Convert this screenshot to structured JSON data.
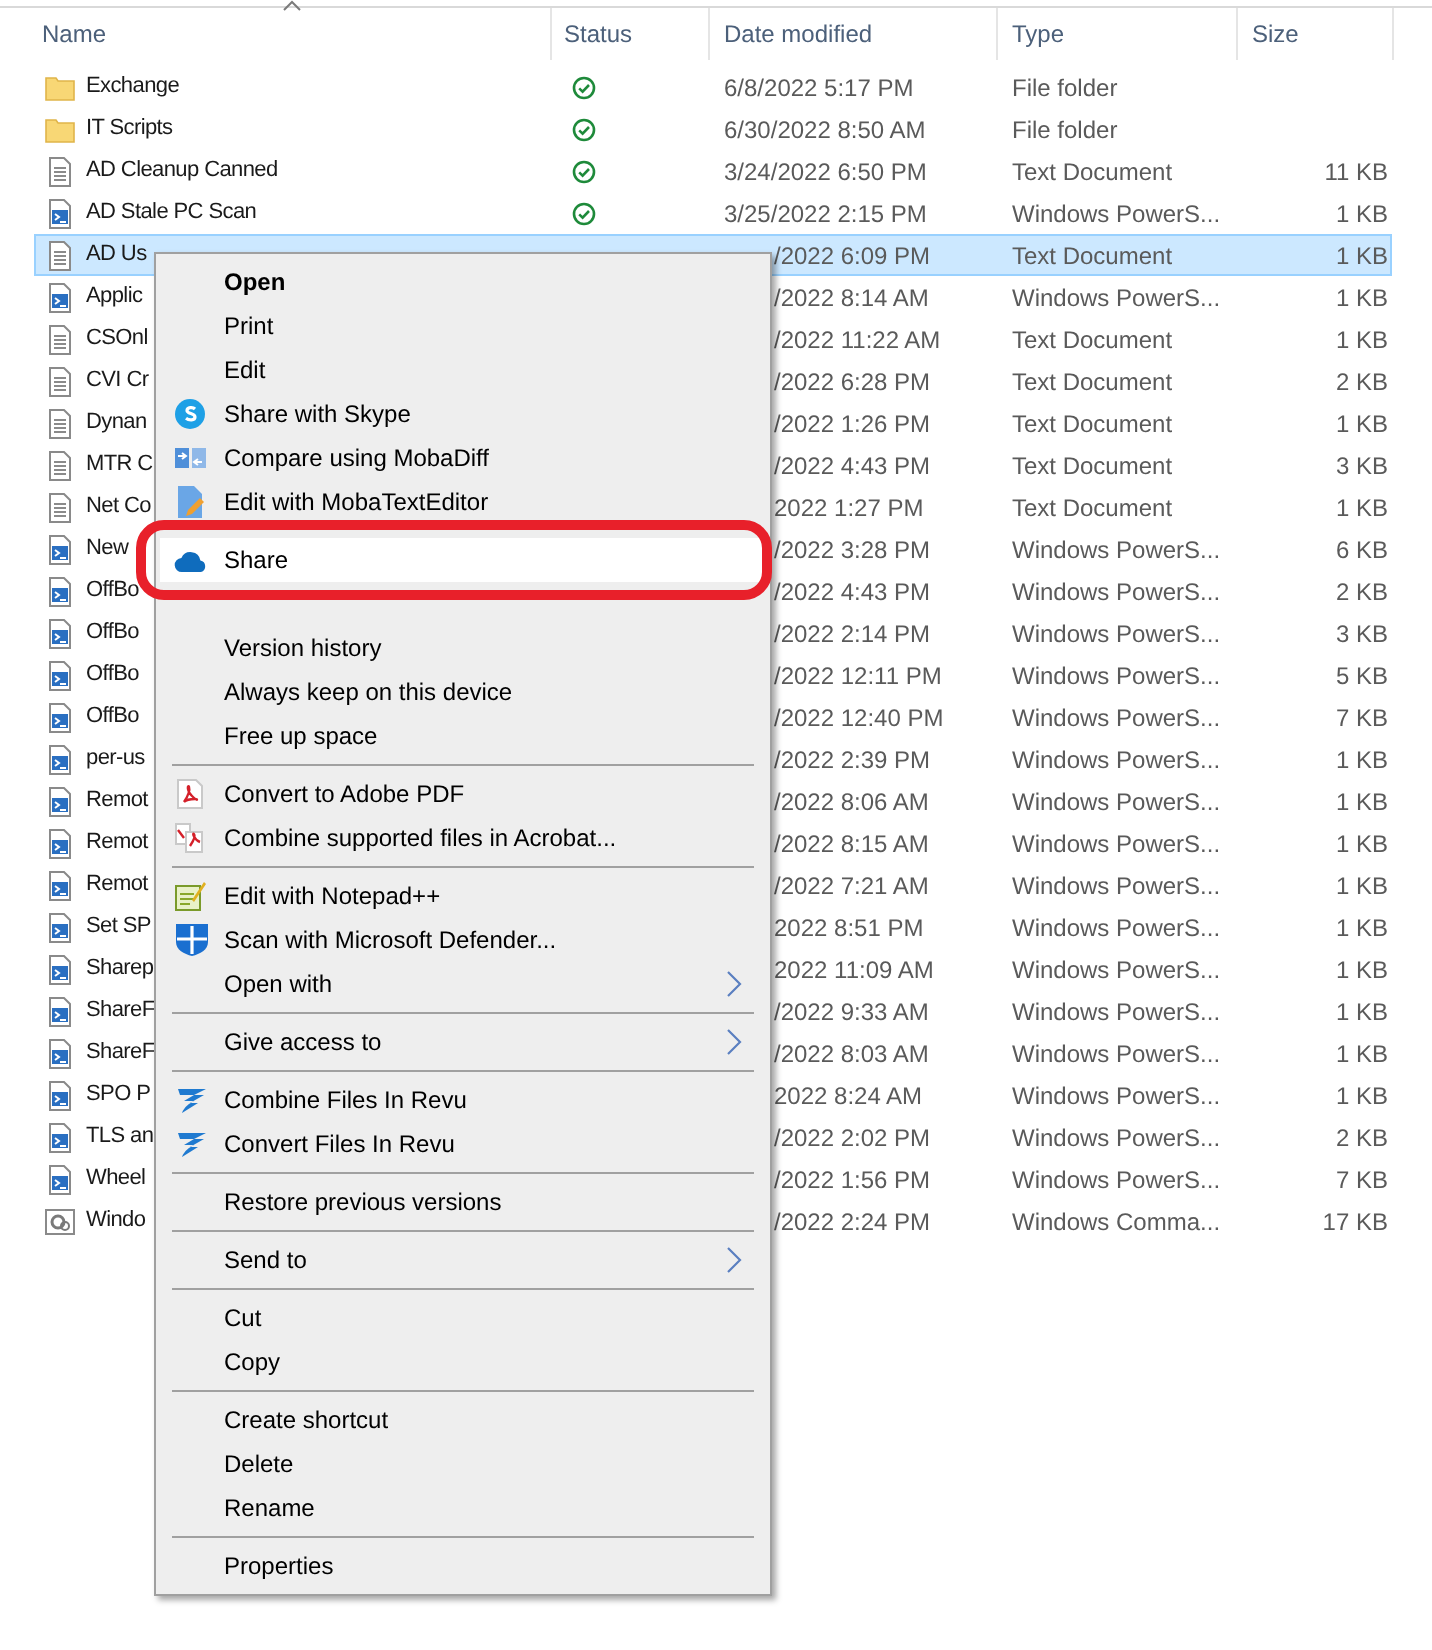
{
  "columns": [
    {
      "label": "Name",
      "sorted": true
    },
    {
      "label": "Status",
      "sorted": false
    },
    {
      "label": "Date modified",
      "sorted": false
    },
    {
      "label": "Type",
      "sorted": false
    },
    {
      "label": "Size",
      "sorted": false
    }
  ],
  "files": [
    {
      "kind": "folder",
      "name": "Exchange",
      "synced": true,
      "date": "6/8/2022 5:17 PM",
      "type": "File folder",
      "selected": false,
      "under_menu": false
    },
    {
      "kind": "folder",
      "name": "IT Scripts",
      "synced": true,
      "date": "6/30/2022 8:50 AM",
      "type": "File folder",
      "selected": false,
      "under_menu": false
    },
    {
      "kind": "text",
      "name": "AD Cleanup Canned",
      "synced": true,
      "date": "3/24/2022 6:50 PM",
      "type": "Text Document",
      "size": "11 KB",
      "selected": false,
      "under_menu": false
    },
    {
      "kind": "script",
      "name": "AD Stale PC Scan",
      "synced": true,
      "date": "3/25/2022 2:15 PM",
      "type": "Windows PowerS...",
      "size": "1 KB",
      "selected": false,
      "under_menu": false
    },
    {
      "kind": "text",
      "name": "AD Us",
      "synced": false,
      "date": "/2022 6:09 PM",
      "type": "Text Document",
      "size": "1 KB",
      "selected": true,
      "under_menu": true
    },
    {
      "kind": "script",
      "name": "Applic",
      "synced": false,
      "date": "/2022 8:14 AM",
      "type": "Windows PowerS...",
      "size": "1 KB",
      "selected": false,
      "under_menu": true
    },
    {
      "kind": "text",
      "name": "CSOnl",
      "synced": false,
      "date": "/2022 11:22 AM",
      "type": "Text Document",
      "size": "1 KB",
      "selected": false,
      "under_menu": true
    },
    {
      "kind": "text",
      "name": "CVI Cr",
      "synced": false,
      "date": "/2022 6:28 PM",
      "type": "Text Document",
      "size": "2 KB",
      "selected": false,
      "under_menu": true
    },
    {
      "kind": "text",
      "name": "Dynan",
      "synced": false,
      "date": "/2022 1:26 PM",
      "type": "Text Document",
      "size": "1 KB",
      "selected": false,
      "under_menu": true
    },
    {
      "kind": "text",
      "name": "MTR C",
      "synced": false,
      "date": "/2022 4:43 PM",
      "type": "Text Document",
      "size": "3 KB",
      "selected": false,
      "under_menu": true
    },
    {
      "kind": "text",
      "name": "Net Co",
      "synced": false,
      "date": "2022 1:27 PM",
      "type": "Text Document",
      "size": "1 KB",
      "selected": false,
      "under_menu": true
    },
    {
      "kind": "script",
      "name": "New",
      "synced": false,
      "date": "/2022 3:28 PM",
      "type": "Windows PowerS...",
      "size": "6 KB",
      "selected": false,
      "under_menu": true
    },
    {
      "kind": "script",
      "name": "OffBo",
      "synced": false,
      "date": "/2022 4:43 PM",
      "type": "Windows PowerS...",
      "size": "2 KB",
      "selected": false,
      "under_menu": true
    },
    {
      "kind": "script",
      "name": "OffBo",
      "synced": false,
      "date": "/2022 2:14 PM",
      "type": "Windows PowerS...",
      "size": "3 KB",
      "selected": false,
      "under_menu": true
    },
    {
      "kind": "script",
      "name": "OffBo",
      "synced": false,
      "date": "/2022 12:11 PM",
      "type": "Windows PowerS...",
      "size": "5 KB",
      "selected": false,
      "under_menu": true
    },
    {
      "kind": "script",
      "name": "OffBo",
      "synced": false,
      "date": "/2022 12:40 PM",
      "type": "Windows PowerS...",
      "size": "7 KB",
      "selected": false,
      "under_menu": true
    },
    {
      "kind": "script",
      "name": "per-us",
      "synced": false,
      "date": "/2022 2:39 PM",
      "type": "Windows PowerS...",
      "size": "1 KB",
      "selected": false,
      "under_menu": true
    },
    {
      "kind": "script",
      "name": "Remot",
      "synced": false,
      "date": "/2022 8:06 AM",
      "type": "Windows PowerS...",
      "size": "1 KB",
      "selected": false,
      "under_menu": true
    },
    {
      "kind": "script",
      "name": "Remot",
      "synced": false,
      "date": "/2022 8:15 AM",
      "type": "Windows PowerS...",
      "size": "1 KB",
      "selected": false,
      "under_menu": true
    },
    {
      "kind": "script",
      "name": "Remot",
      "synced": false,
      "date": "/2022 7:21 AM",
      "type": "Windows PowerS...",
      "size": "1 KB",
      "selected": false,
      "under_menu": true
    },
    {
      "kind": "script",
      "name": "Set SP",
      "synced": false,
      "date": "2022 8:51 PM",
      "type": "Windows PowerS...",
      "size": "1 KB",
      "selected": false,
      "under_menu": true
    },
    {
      "kind": "script",
      "name": "Sharep",
      "synced": false,
      "date": "2022 11:09 AM",
      "type": "Windows PowerS...",
      "size": "1 KB",
      "selected": false,
      "under_menu": true
    },
    {
      "kind": "script",
      "name": "ShareF",
      "synced": false,
      "date": "/2022 9:33 AM",
      "type": "Windows PowerS...",
      "size": "1 KB",
      "selected": false,
      "under_menu": true
    },
    {
      "kind": "script",
      "name": "ShareF",
      "synced": false,
      "date": "/2022 8:03 AM",
      "type": "Windows PowerS...",
      "size": "1 KB",
      "selected": false,
      "under_menu": true
    },
    {
      "kind": "script",
      "name": "SPO P",
      "synced": false,
      "date": "2022 8:24 AM",
      "type": "Windows PowerS...",
      "size": "1 KB",
      "selected": false,
      "under_menu": true
    },
    {
      "kind": "script",
      "name": "TLS an",
      "synced": false,
      "date": "/2022 2:02 PM",
      "type": "Windows PowerS...",
      "size": "2 KB",
      "selected": false,
      "under_menu": true
    },
    {
      "kind": "script",
      "name": "Wheel",
      "synced": false,
      "date": "/2022 1:56 PM",
      "type": "Windows PowerS...",
      "size": "7 KB",
      "selected": false,
      "under_menu": true
    },
    {
      "kind": "batch",
      "name": "Windo",
      "synced": false,
      "date": "/2022 2:24 PM",
      "type": "Windows Comma...",
      "size": "17 KB",
      "selected": false,
      "under_menu": true
    }
  ],
  "context_menu": [
    {
      "kind": "plain",
      "label": "Open",
      "default": true
    },
    {
      "kind": "plain",
      "label": "Print",
      "default": false
    },
    {
      "kind": "plain",
      "label": "Edit",
      "default": false
    },
    {
      "kind": "bubble",
      "label": "Share with Skype",
      "default": false
    },
    {
      "kind": "compare",
      "label": "Compare using MobaDiff",
      "default": false
    },
    {
      "kind": "pencil",
      "label": "Edit with MobaTextEditor",
      "default": false
    },
    {
      "kind": "cloud",
      "label": "Share",
      "default": false,
      "highlighted": true,
      "circled": true
    },
    {
      "kind": "plain",
      "label": "Version history",
      "default": false
    },
    {
      "kind": "plain",
      "label": "Always keep on this device",
      "default": false
    },
    {
      "kind": "plain",
      "label": "Free up space",
      "default": false
    },
    {
      "kind": "separator"
    },
    {
      "kind": "pdf",
      "label": "Convert to Adobe PDF",
      "default": false
    },
    {
      "kind": "pdfcombine",
      "label": "Combine supported files in Acrobat...",
      "default": false
    },
    {
      "kind": "separator"
    },
    {
      "kind": "notepad",
      "label": "Edit with Notepad++",
      "default": false
    },
    {
      "kind": "shield",
      "label": "Scan with Microsoft Defender...",
      "default": false
    },
    {
      "kind": "plain",
      "label": "Open with",
      "default": false,
      "submenu": true
    },
    {
      "kind": "separator"
    },
    {
      "kind": "plain",
      "label": "Give access to",
      "default": false,
      "submenu": true
    },
    {
      "kind": "separator"
    },
    {
      "kind": "swoosh",
      "label": "Combine Files In Revu",
      "default": false
    },
    {
      "kind": "swoosh",
      "label": "Convert Files In Revu",
      "default": false
    },
    {
      "kind": "separator"
    },
    {
      "kind": "plain",
      "label": "Restore previous versions",
      "default": false
    },
    {
      "kind": "separator"
    },
    {
      "kind": "plain",
      "label": "Send to",
      "default": false,
      "submenu": true
    },
    {
      "kind": "separator"
    },
    {
      "kind": "plain",
      "label": "Cut",
      "default": false
    },
    {
      "kind": "plain",
      "label": "Copy",
      "default": false
    },
    {
      "kind": "separator"
    },
    {
      "kind": "plain",
      "label": "Create shortcut",
      "default": false
    },
    {
      "kind": "plain",
      "label": "Delete",
      "default": false
    },
    {
      "kind": "plain",
      "label": "Rename",
      "default": false
    },
    {
      "kind": "separator"
    },
    {
      "kind": "plain",
      "label": "Properties",
      "default": false
    }
  ]
}
